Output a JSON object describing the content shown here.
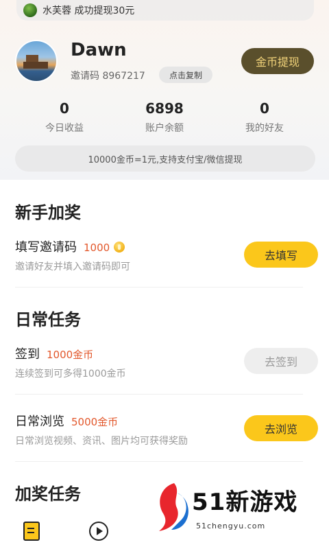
{
  "marquee": {
    "text": "水芙蓉 成功提现30元"
  },
  "profile": {
    "username": "Dawn",
    "invite_text": "邀请码 8967217",
    "copy_label": "点击复制",
    "withdraw_label": "金币提现"
  },
  "stats": [
    {
      "value": "0",
      "label": "今日收益"
    },
    {
      "value": "6898",
      "label": "账户余额"
    },
    {
      "value": "0",
      "label": "我的好友"
    }
  ],
  "rate_text": "10000金币=1元,支持支付宝/微信提现",
  "sections": {
    "newbie": {
      "title": "新手加奖",
      "task": {
        "name": "填写邀请码",
        "reward": "1000",
        "desc": "邀请好友并填入邀请码即可",
        "button": "去填写"
      }
    },
    "daily": {
      "title": "日常任务",
      "tasks": [
        {
          "name": "签到",
          "reward": "1000金币",
          "desc": "连续签到可多得1000金币",
          "button": "去签到"
        },
        {
          "name": "日常浏览",
          "reward": "5000金币",
          "desc": "日常浏览视频、资讯、图片均可获得奖励",
          "button": "去浏览"
        }
      ]
    },
    "bonus": {
      "title": "加奖任务"
    }
  },
  "watermark": {
    "brand": "51新游戏",
    "url": "51chengyu.com"
  },
  "colors": {
    "accent_yellow": "#fbc71b",
    "reward_red": "#e2572b",
    "withdraw_bg": "#5a4f2c",
    "withdraw_text": "#f2d37a"
  }
}
